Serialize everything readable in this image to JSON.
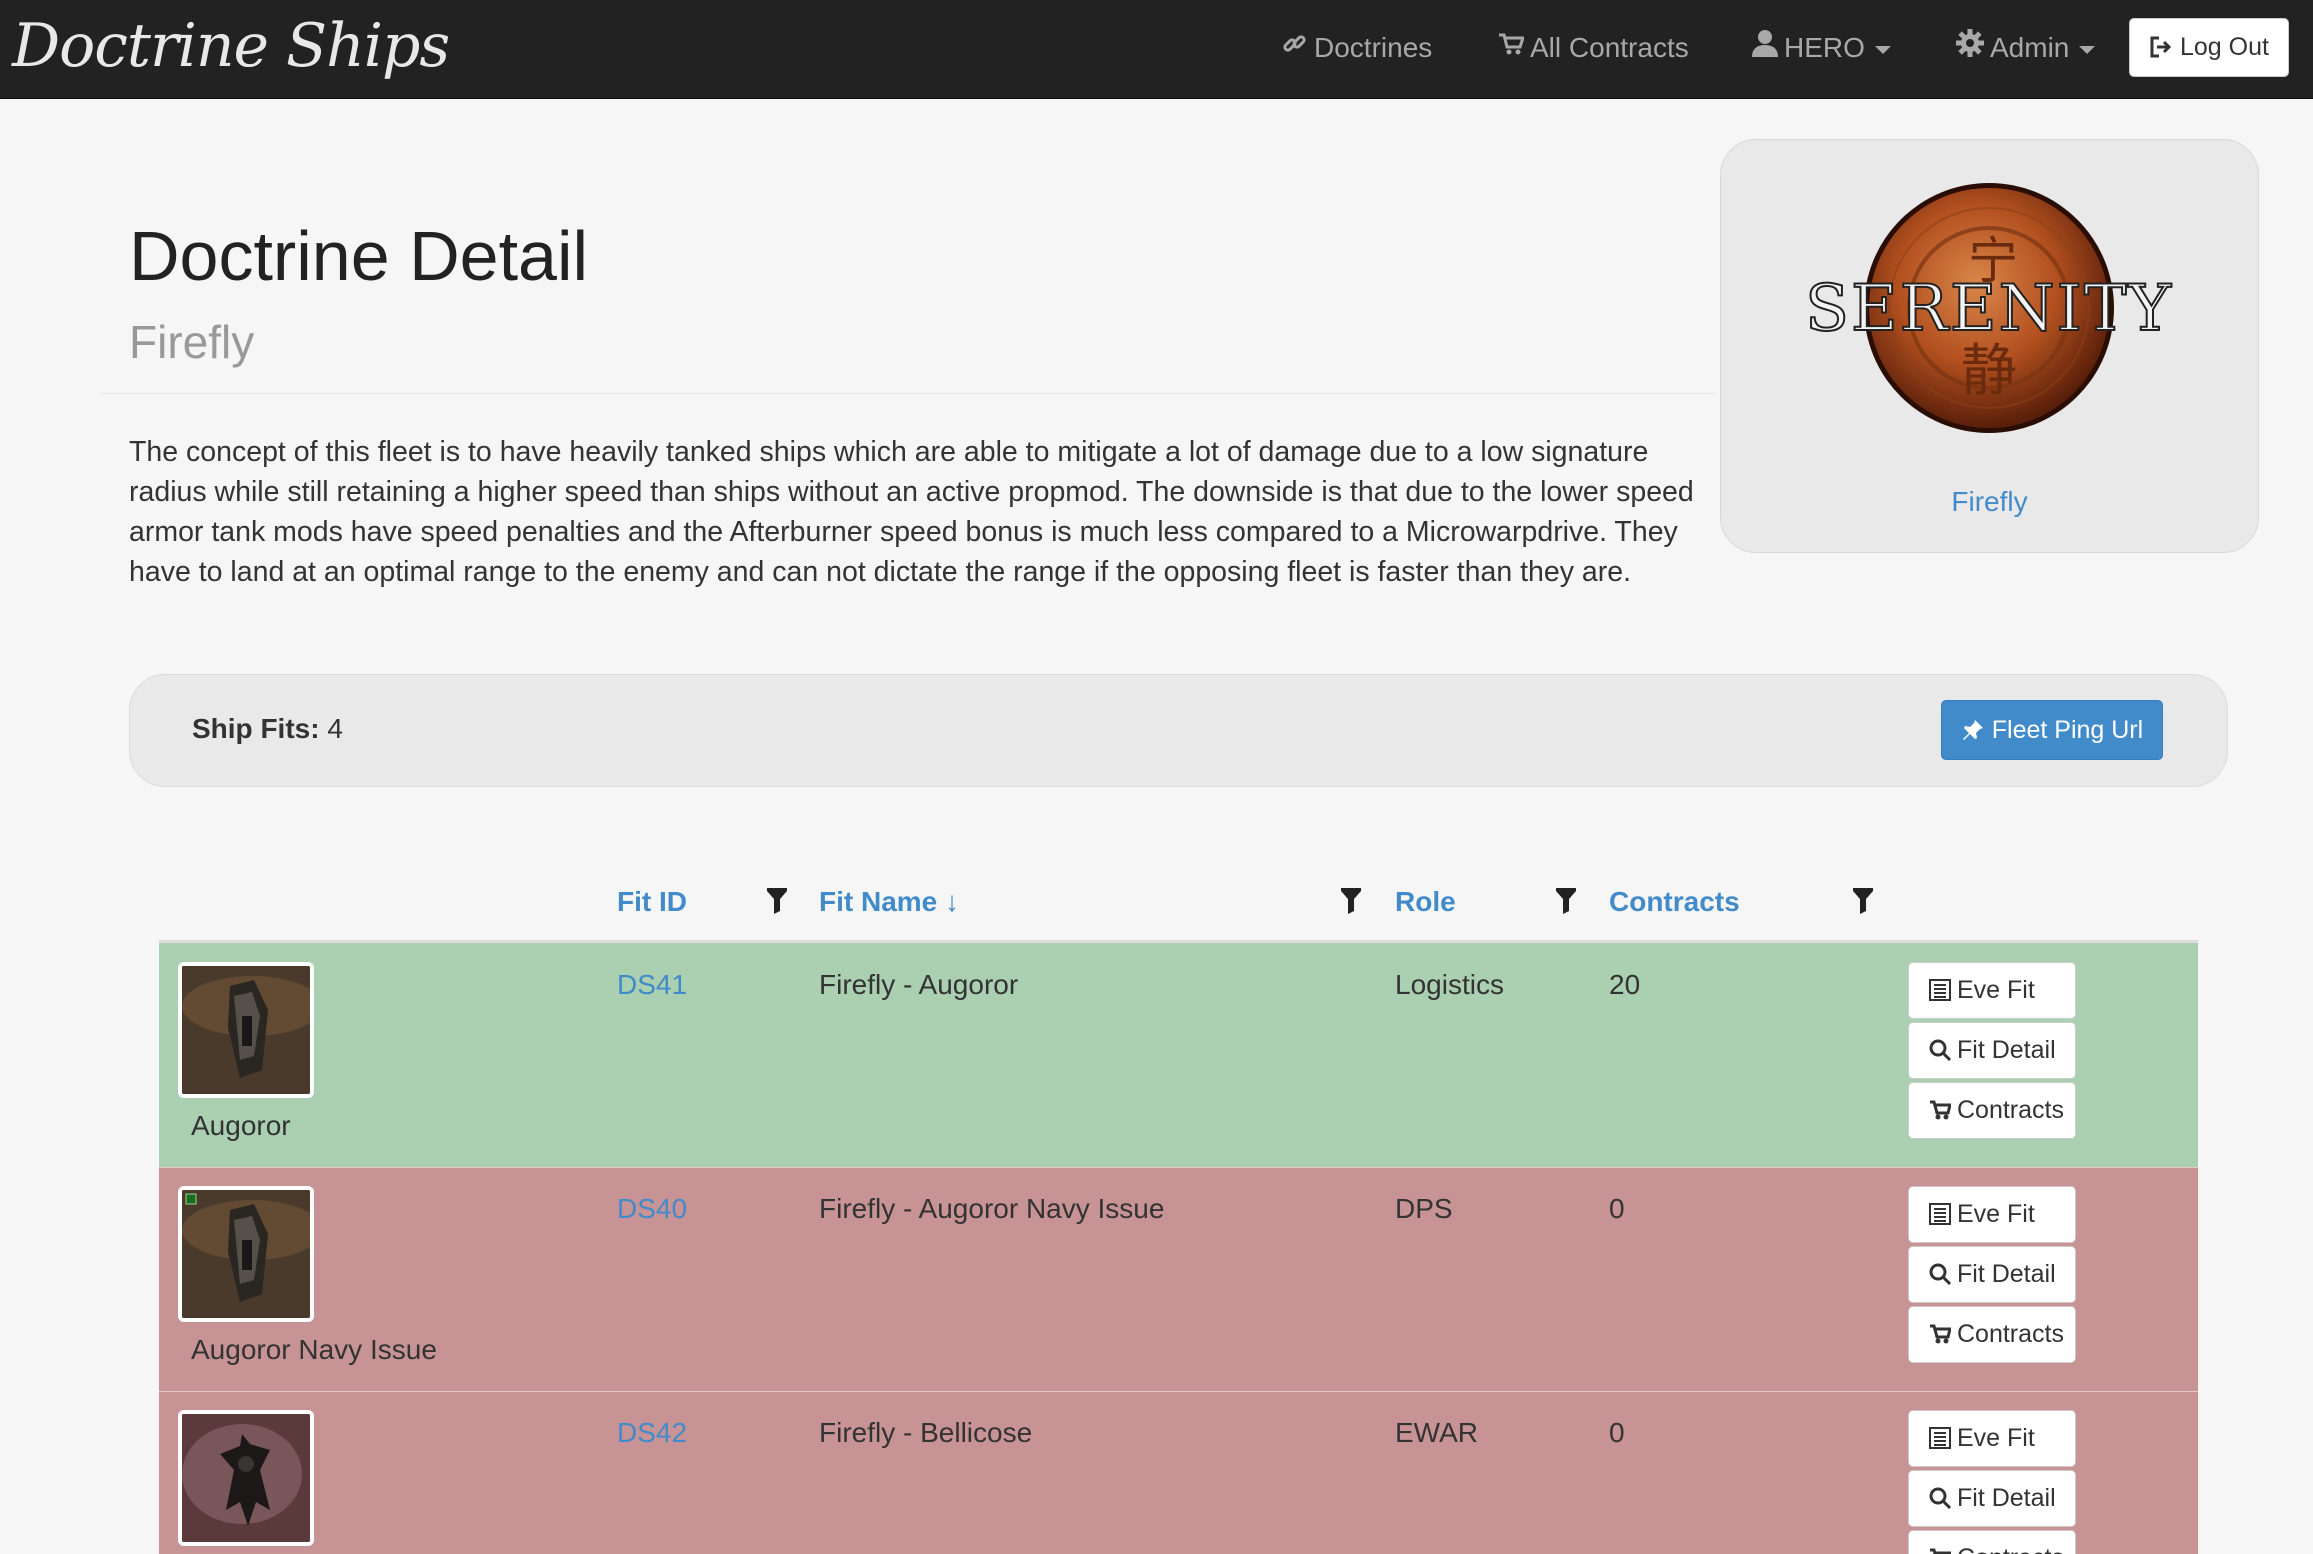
{
  "nav": {
    "brand": "Doctrine Ships",
    "doctrines": "Doctrines",
    "all_contracts": "All Contracts",
    "user": "HERO",
    "admin": "Admin",
    "logout": "Log Out"
  },
  "header": {
    "title": "Doctrine Detail",
    "subtitle": "Firefly",
    "description": "The concept of this fleet is to have heavily tanked ships which are able to mitigate a lot of damage due to a low signature radius while still retaining a higher speed than ships without an active propmod. The downside is that due to the lower speed armor tank mods have speed penalties and the Afterburner speed bonus is much less compared to a Microwarpdrive. They have to land at an optimal range to the enemy and can not dictate the range if the opposing fleet is faster than they are."
  },
  "thumbnail": {
    "logo_text": "SERENITY",
    "logo_glyph_1": "宁",
    "logo_glyph_2": "静",
    "caption": "Firefly"
  },
  "ship_fits": {
    "label": "Ship Fits:",
    "count": "4",
    "ping_button": "Fleet Ping Url"
  },
  "table": {
    "headers": {
      "fit_id": "Fit ID",
      "fit_name": "Fit Name ↓",
      "role": "Role",
      "contracts": "Contracts"
    },
    "buttons": {
      "eve_fit": "Eve Fit",
      "fit_detail": "Fit Detail",
      "contracts": "Contracts"
    },
    "rows": [
      {
        "ship": "Augoror",
        "fit_id": "DS41",
        "fit_name": "Firefly - Augoror",
        "role": "Logistics",
        "contracts": "20",
        "status": "success"
      },
      {
        "ship": "Augoror Navy Issue",
        "fit_id": "DS40",
        "fit_name": "Firefly - Augoror Navy Issue",
        "role": "DPS",
        "contracts": "0",
        "status": "danger"
      },
      {
        "ship": "",
        "fit_id": "DS42",
        "fit_name": "Firefly - Bellicose",
        "role": "EWAR",
        "contracts": "0",
        "status": "danger"
      }
    ]
  },
  "colors": {
    "navbar": "#222222",
    "link": "#428bca",
    "row_success": "#aacfb1",
    "row_danger": "#c89394",
    "primary_button": "#428bca"
  },
  "icons": [
    "link-icon",
    "cart-icon",
    "user-icon",
    "gear-icon",
    "logout-icon",
    "pushpin-icon",
    "filter-icon",
    "list-icon",
    "search-icon",
    "cart-icon"
  ]
}
